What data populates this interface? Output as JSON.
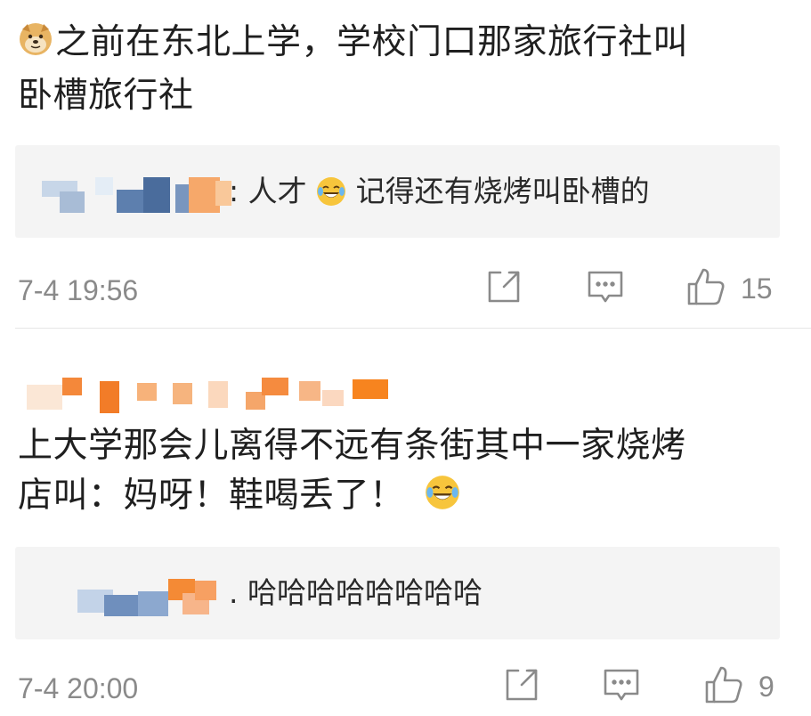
{
  "comments": [
    {
      "emoji_prefix": "doge-emoji",
      "line1": "之前在东北上学，学校门口那家旅行社叫",
      "line2": "卧槽旅行社",
      "reply": {
        "prefix": ": 人才",
        "emoji": "laugh-cry-emoji",
        "suffix": " 记得还有烧烤叫卧槽的"
      },
      "timestamp": "7-4 19:56",
      "like_count": "15"
    },
    {
      "line1": "上大学那会儿离得不远有条街其中一家烧烤",
      "line2": "店叫：妈呀！鞋喝丢了！",
      "line2_emoji": "laugh-cry-emoji",
      "reply": {
        "prefix": ". 哈哈哈哈哈哈哈哈"
      },
      "timestamp": "7-4 20:00",
      "like_count": "9"
    }
  ],
  "icons": {
    "share": "share-icon",
    "comment": "comment-icon",
    "like": "thumbs-up-icon"
  },
  "colors": {
    "meta_gray": "#8a8a8a",
    "reply_bg": "#f4f4f4",
    "divider": "#e6e6e6"
  }
}
